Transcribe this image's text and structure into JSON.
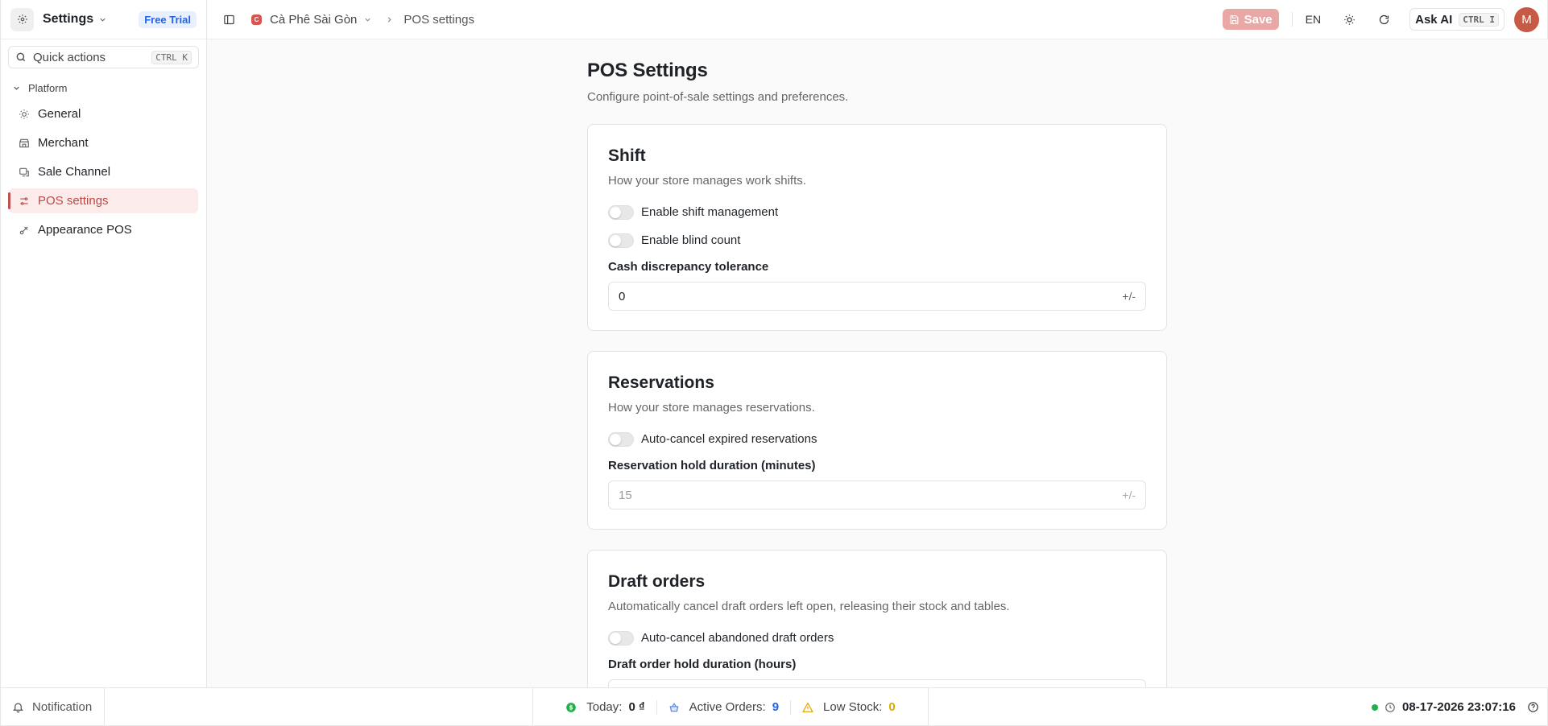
{
  "sidebar": {
    "app_title": "Settings",
    "badge": "Free Trial",
    "search_label": "Quick actions",
    "search_shortcut": "CTRL K",
    "group_label": "Platform",
    "items": [
      {
        "label": "General",
        "icon": "sun-icon"
      },
      {
        "label": "Merchant",
        "icon": "store-icon"
      },
      {
        "label": "Sale Channel",
        "icon": "channel-icon"
      },
      {
        "label": "POS settings",
        "icon": "sliders-icon",
        "active": true
      },
      {
        "label": "Appearance POS",
        "icon": "palette-icon"
      }
    ]
  },
  "topbar": {
    "store_initial": "C",
    "store_name": "Cà Phê Sài Gòn",
    "breadcrumb_page": "POS settings",
    "save_label": "Save",
    "language": "EN",
    "ask_ai_label": "Ask AI",
    "ask_ai_shortcut": "CTRL I",
    "avatar_initial": "M"
  },
  "page": {
    "title": "POS Settings",
    "subtitle": "Configure point-of-sale settings and preferences.",
    "sections": {
      "shift": {
        "title": "Shift",
        "subtitle": "How your store manages work shifts.",
        "toggle_shift": "Enable shift management",
        "toggle_blind": "Enable blind count",
        "field_label": "Cash discrepancy tolerance",
        "field_value": "0",
        "field_suffix": "+/-"
      },
      "reservations": {
        "title": "Reservations",
        "subtitle": "How your store manages reservations.",
        "toggle_autocancel": "Auto-cancel expired reservations",
        "field_label": "Reservation hold duration (minutes)",
        "field_value": "15",
        "field_suffix": "+/-"
      },
      "draft": {
        "title": "Draft orders",
        "subtitle": "Automatically cancel draft orders left open, releasing their stock and tables.",
        "toggle_autocancel": "Auto-cancel abandoned draft orders",
        "field_label": "Draft order hold duration (hours)"
      }
    }
  },
  "statusbar": {
    "notification_label": "Notification",
    "today_label": "Today:",
    "today_value": "0 ₫",
    "active_orders_label": "Active Orders:",
    "active_orders_value": "9",
    "low_stock_label": "Low Stock:",
    "low_stock_value": "0",
    "datetime": "08-17-2026 23:07:16"
  },
  "colors": {
    "accent": "#c0504d",
    "active_bg": "#fbebeb",
    "today_value": "#1f2328",
    "orders_value": "#2563eb",
    "stock_value": "#e0a800",
    "online": "#22b04b"
  }
}
